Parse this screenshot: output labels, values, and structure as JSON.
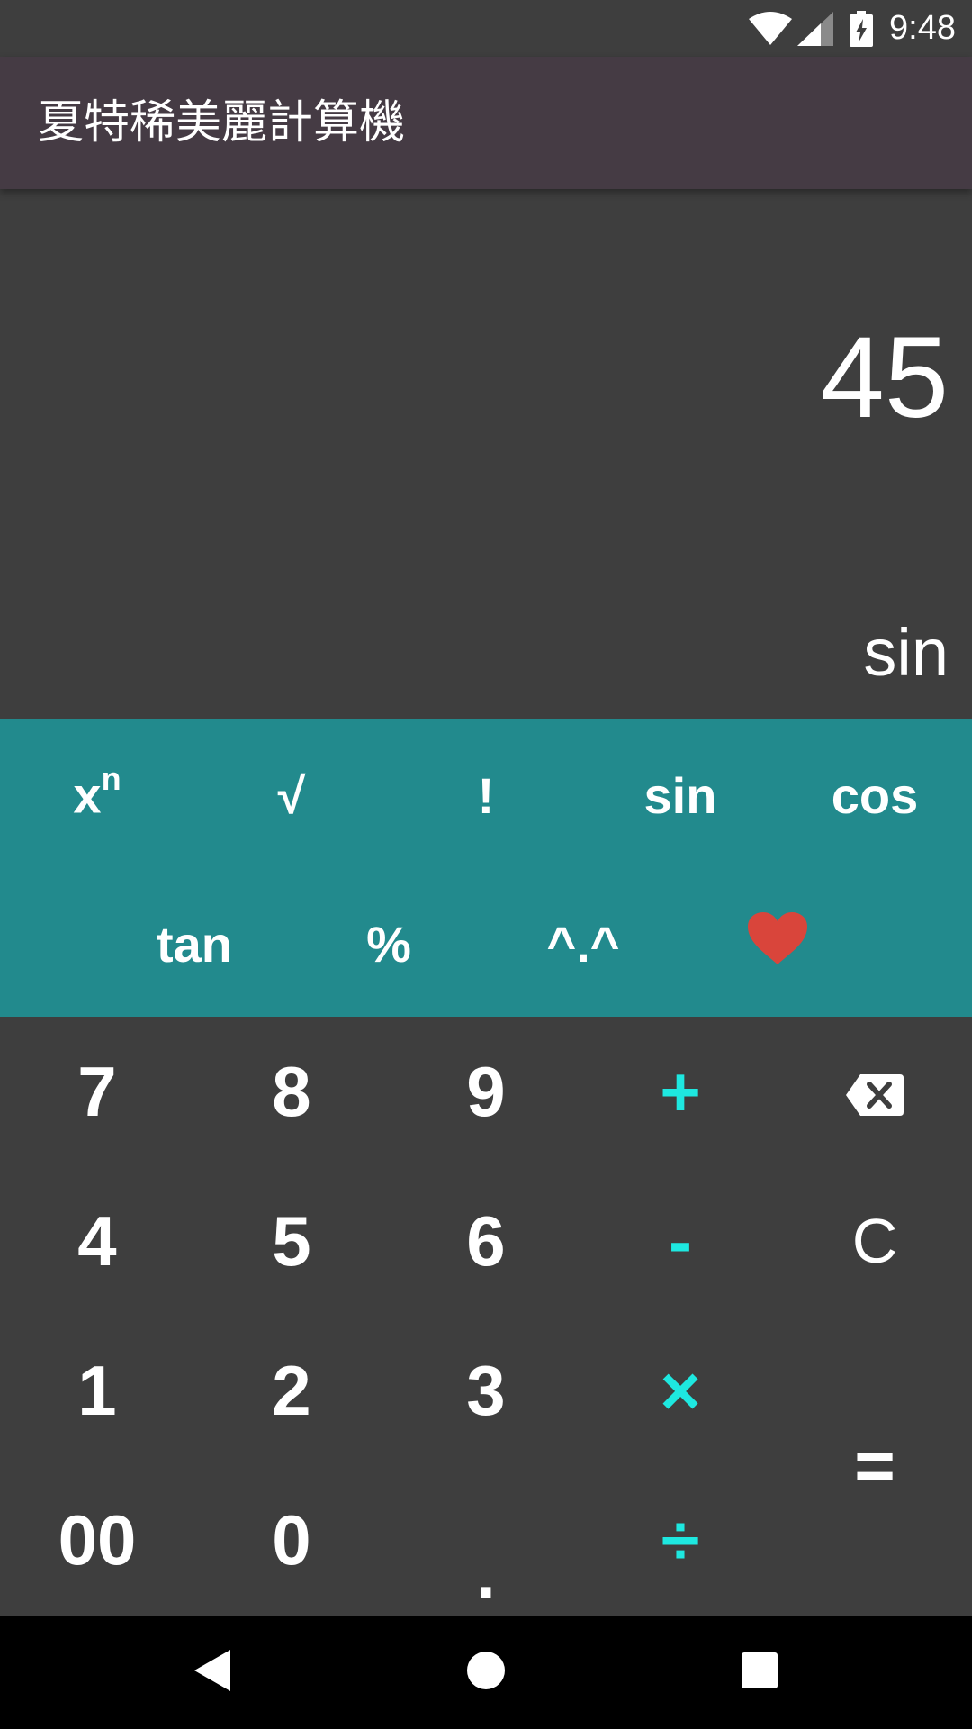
{
  "status_bar": {
    "time": "9:48",
    "icons": [
      "wifi-icon",
      "signal-icon",
      "battery-charging-icon"
    ]
  },
  "app_bar": {
    "title": "夏特稀美麗計算機",
    "background": "#453b44"
  },
  "display": {
    "value": "45",
    "operation": "sin"
  },
  "scientific_keys": {
    "row1": [
      "x",
      "√",
      "!",
      "sin",
      "cos"
    ],
    "power_superscript": "n",
    "row2": [
      "tan",
      "%",
      "^.^",
      "heart-icon"
    ],
    "background": "#228a8d",
    "heart_color": "#d9453b"
  },
  "keypad": {
    "row1": [
      "7",
      "8",
      "9",
      "+",
      "backspace-icon"
    ],
    "row2": [
      "4",
      "5",
      "6",
      "-",
      "C"
    ],
    "row3": [
      "1",
      "2",
      "3",
      "×"
    ],
    "row4": [
      "00",
      "0",
      ".",
      "÷"
    ],
    "equals": "=",
    "operator_color": "#1ee8e0"
  },
  "nav_bar": {
    "buttons": [
      "back-icon",
      "home-icon",
      "recents-icon"
    ]
  }
}
